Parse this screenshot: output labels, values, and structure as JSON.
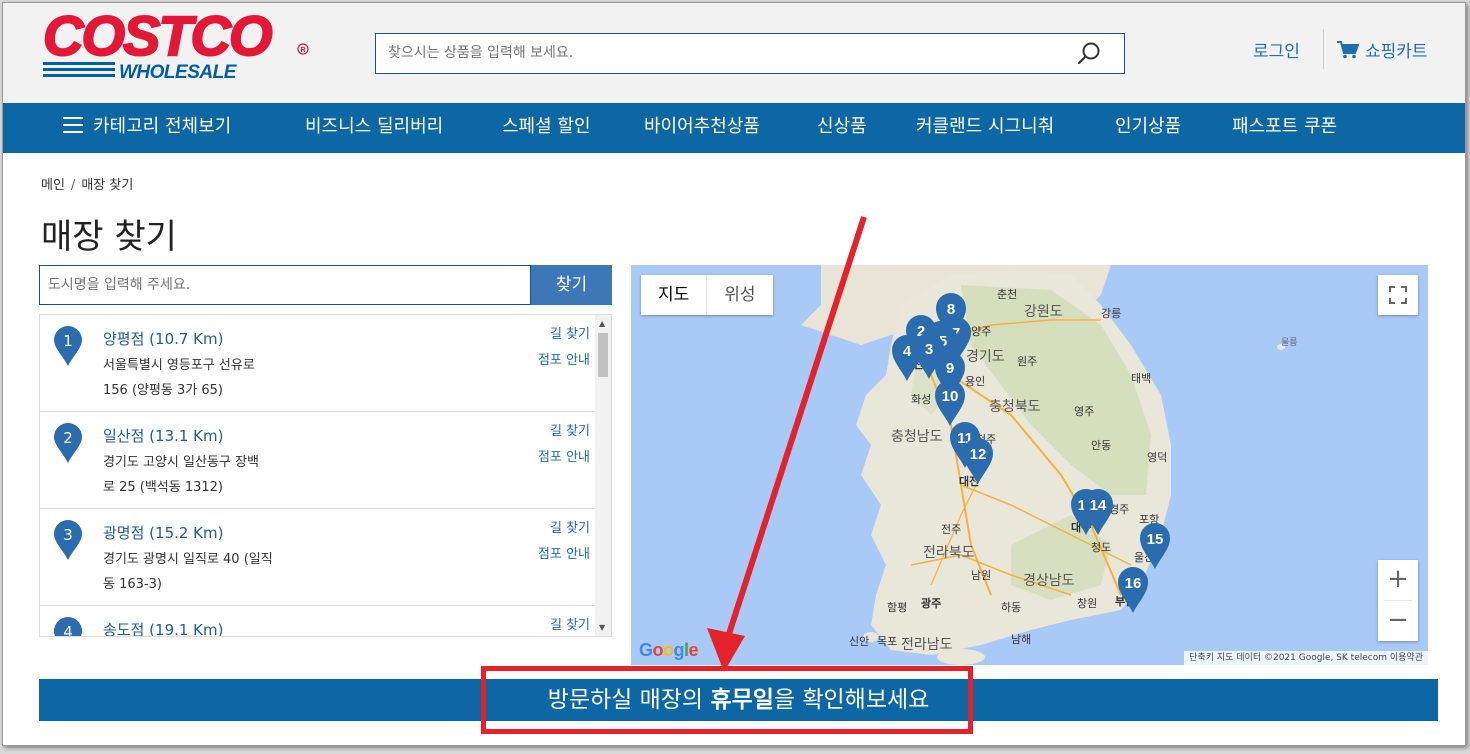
{
  "brand": {
    "logo_top": "COSTCO",
    "logo_bottom": "WHOLESALE",
    "colors": {
      "red": "#e31837",
      "blue": "#005daa",
      "nav": "#0e67a5"
    }
  },
  "header": {
    "search_placeholder": "찾으시는 상품을 입력해 보세요.",
    "login": "로그인",
    "cart": "쇼핑카트"
  },
  "nav": {
    "items": [
      "카테고리 전체보기",
      "비즈니스 딜리버리",
      "스페셜 할인",
      "바이어추천상품",
      "신상품",
      "커클랜드 시그니춰",
      "인기상품",
      "패스포트 쿠폰"
    ]
  },
  "breadcrumb": {
    "home": "메인",
    "sep": "/",
    "current": "매장 찾기"
  },
  "page_title": "매장 찾기",
  "city_search": {
    "placeholder": "도시명을 입력해 주세요.",
    "button": "찾기"
  },
  "stores": [
    {
      "num": "1",
      "name": "양평점 (10.7 Km)",
      "addr1": "서울특별시 영등포구 선유로",
      "addr2": "156 (양평동 3가 65)",
      "dir": "길 찾기",
      "info": "점포 안내"
    },
    {
      "num": "2",
      "name": "일산점 (13.1 Km)",
      "addr1": "경기도 고양시 일산동구 장백",
      "addr2": "로 25 (백석동 1312)",
      "dir": "길 찾기",
      "info": "점포 안내"
    },
    {
      "num": "3",
      "name": "광명점 (15.2 Km)",
      "addr1": "경기도 광명시 일직로 40 (일직",
      "addr2": "동 163-3)",
      "dir": "길 찾기",
      "info": "점포 안내"
    },
    {
      "num": "4",
      "name": "송도점 (19.1 Km)",
      "addr1": "",
      "addr2": "",
      "dir": "길 찾기",
      "info": ""
    }
  ],
  "map": {
    "tab_map": "지도",
    "tab_satellite": "위성",
    "zoom_in": "+",
    "zoom_out": "−",
    "google": [
      "G",
      "o",
      "o",
      "g",
      "l",
      "e"
    ],
    "attribution": "단축키   지도 데이터 ©2021 Google, SK telecom   이용약관",
    "places": [
      "춘천",
      "강원도",
      "강릉",
      "남양주",
      "인천",
      "경기도",
      "원주",
      "용인",
      "울릉",
      "화성",
      "충청북도",
      "태백",
      "영주",
      "충청남도",
      "청주",
      "안동",
      "영덕",
      "대전",
      "포항",
      "대구",
      "경주",
      "청도",
      "전주",
      "전라북도",
      "울산",
      "남원",
      "경상남도",
      "함평",
      "광주",
      "하동",
      "창원",
      "신안",
      "목포",
      "전라남도",
      "남해",
      "부산"
    ],
    "markers": [
      "1",
      "2",
      "3",
      "4",
      "5",
      "6",
      "7",
      "8",
      "9",
      "10",
      "11",
      "12",
      "13",
      "14",
      "15",
      "16"
    ]
  },
  "banner": {
    "before": "방문하실 매장의 ",
    "bold": "휴무일",
    "after": "을 확인해보세요"
  }
}
